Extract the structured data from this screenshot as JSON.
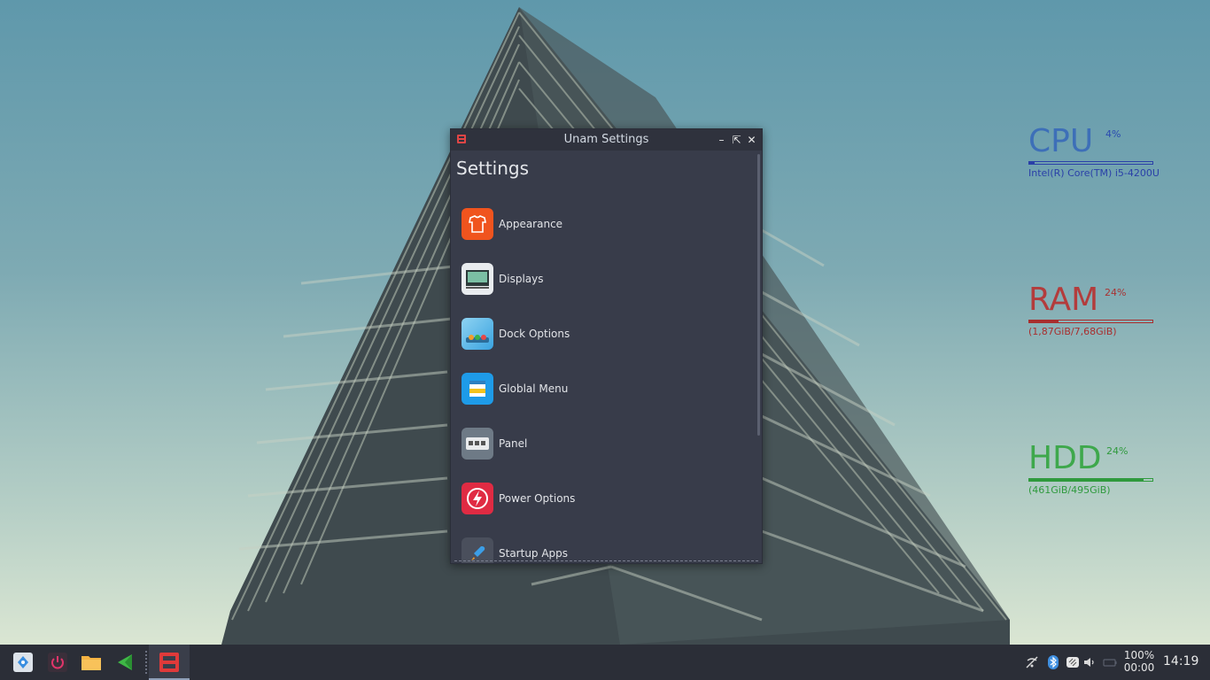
{
  "window": {
    "title": "Unam Settings",
    "heading": "Settings",
    "items": [
      {
        "label": "Appearance",
        "icon": "appearance-icon"
      },
      {
        "label": "Displays",
        "icon": "displays-icon"
      },
      {
        "label": "Dock Options",
        "icon": "dock-options-icon"
      },
      {
        "label": "Globlal Menu",
        "icon": "global-menu-icon"
      },
      {
        "label": "Panel",
        "icon": "panel-icon"
      },
      {
        "label": "Power Options",
        "icon": "power-options-icon"
      },
      {
        "label": "Startup Apps",
        "icon": "startup-apps-icon"
      }
    ]
  },
  "widgets": {
    "cpu": {
      "name": "CPU",
      "percent": "4%",
      "detail": "Intel(R) Core(TM) i5-4200U",
      "color": "#2f58b6",
      "level": 0.04
    },
    "ram": {
      "name": "RAM",
      "percent": "24%",
      "detail": "(1,87GiB/7,68GiB)",
      "color": "#b03a3a",
      "level": 0.24
    },
    "hdd": {
      "name": "HDD",
      "percent": "24%",
      "detail": "(461GiB/495GiB)",
      "color": "#3aa84a",
      "level": 0.93
    }
  },
  "taskbar": {
    "battery_percent": "100%",
    "battery_time": "00:00",
    "clock": "14:19"
  }
}
